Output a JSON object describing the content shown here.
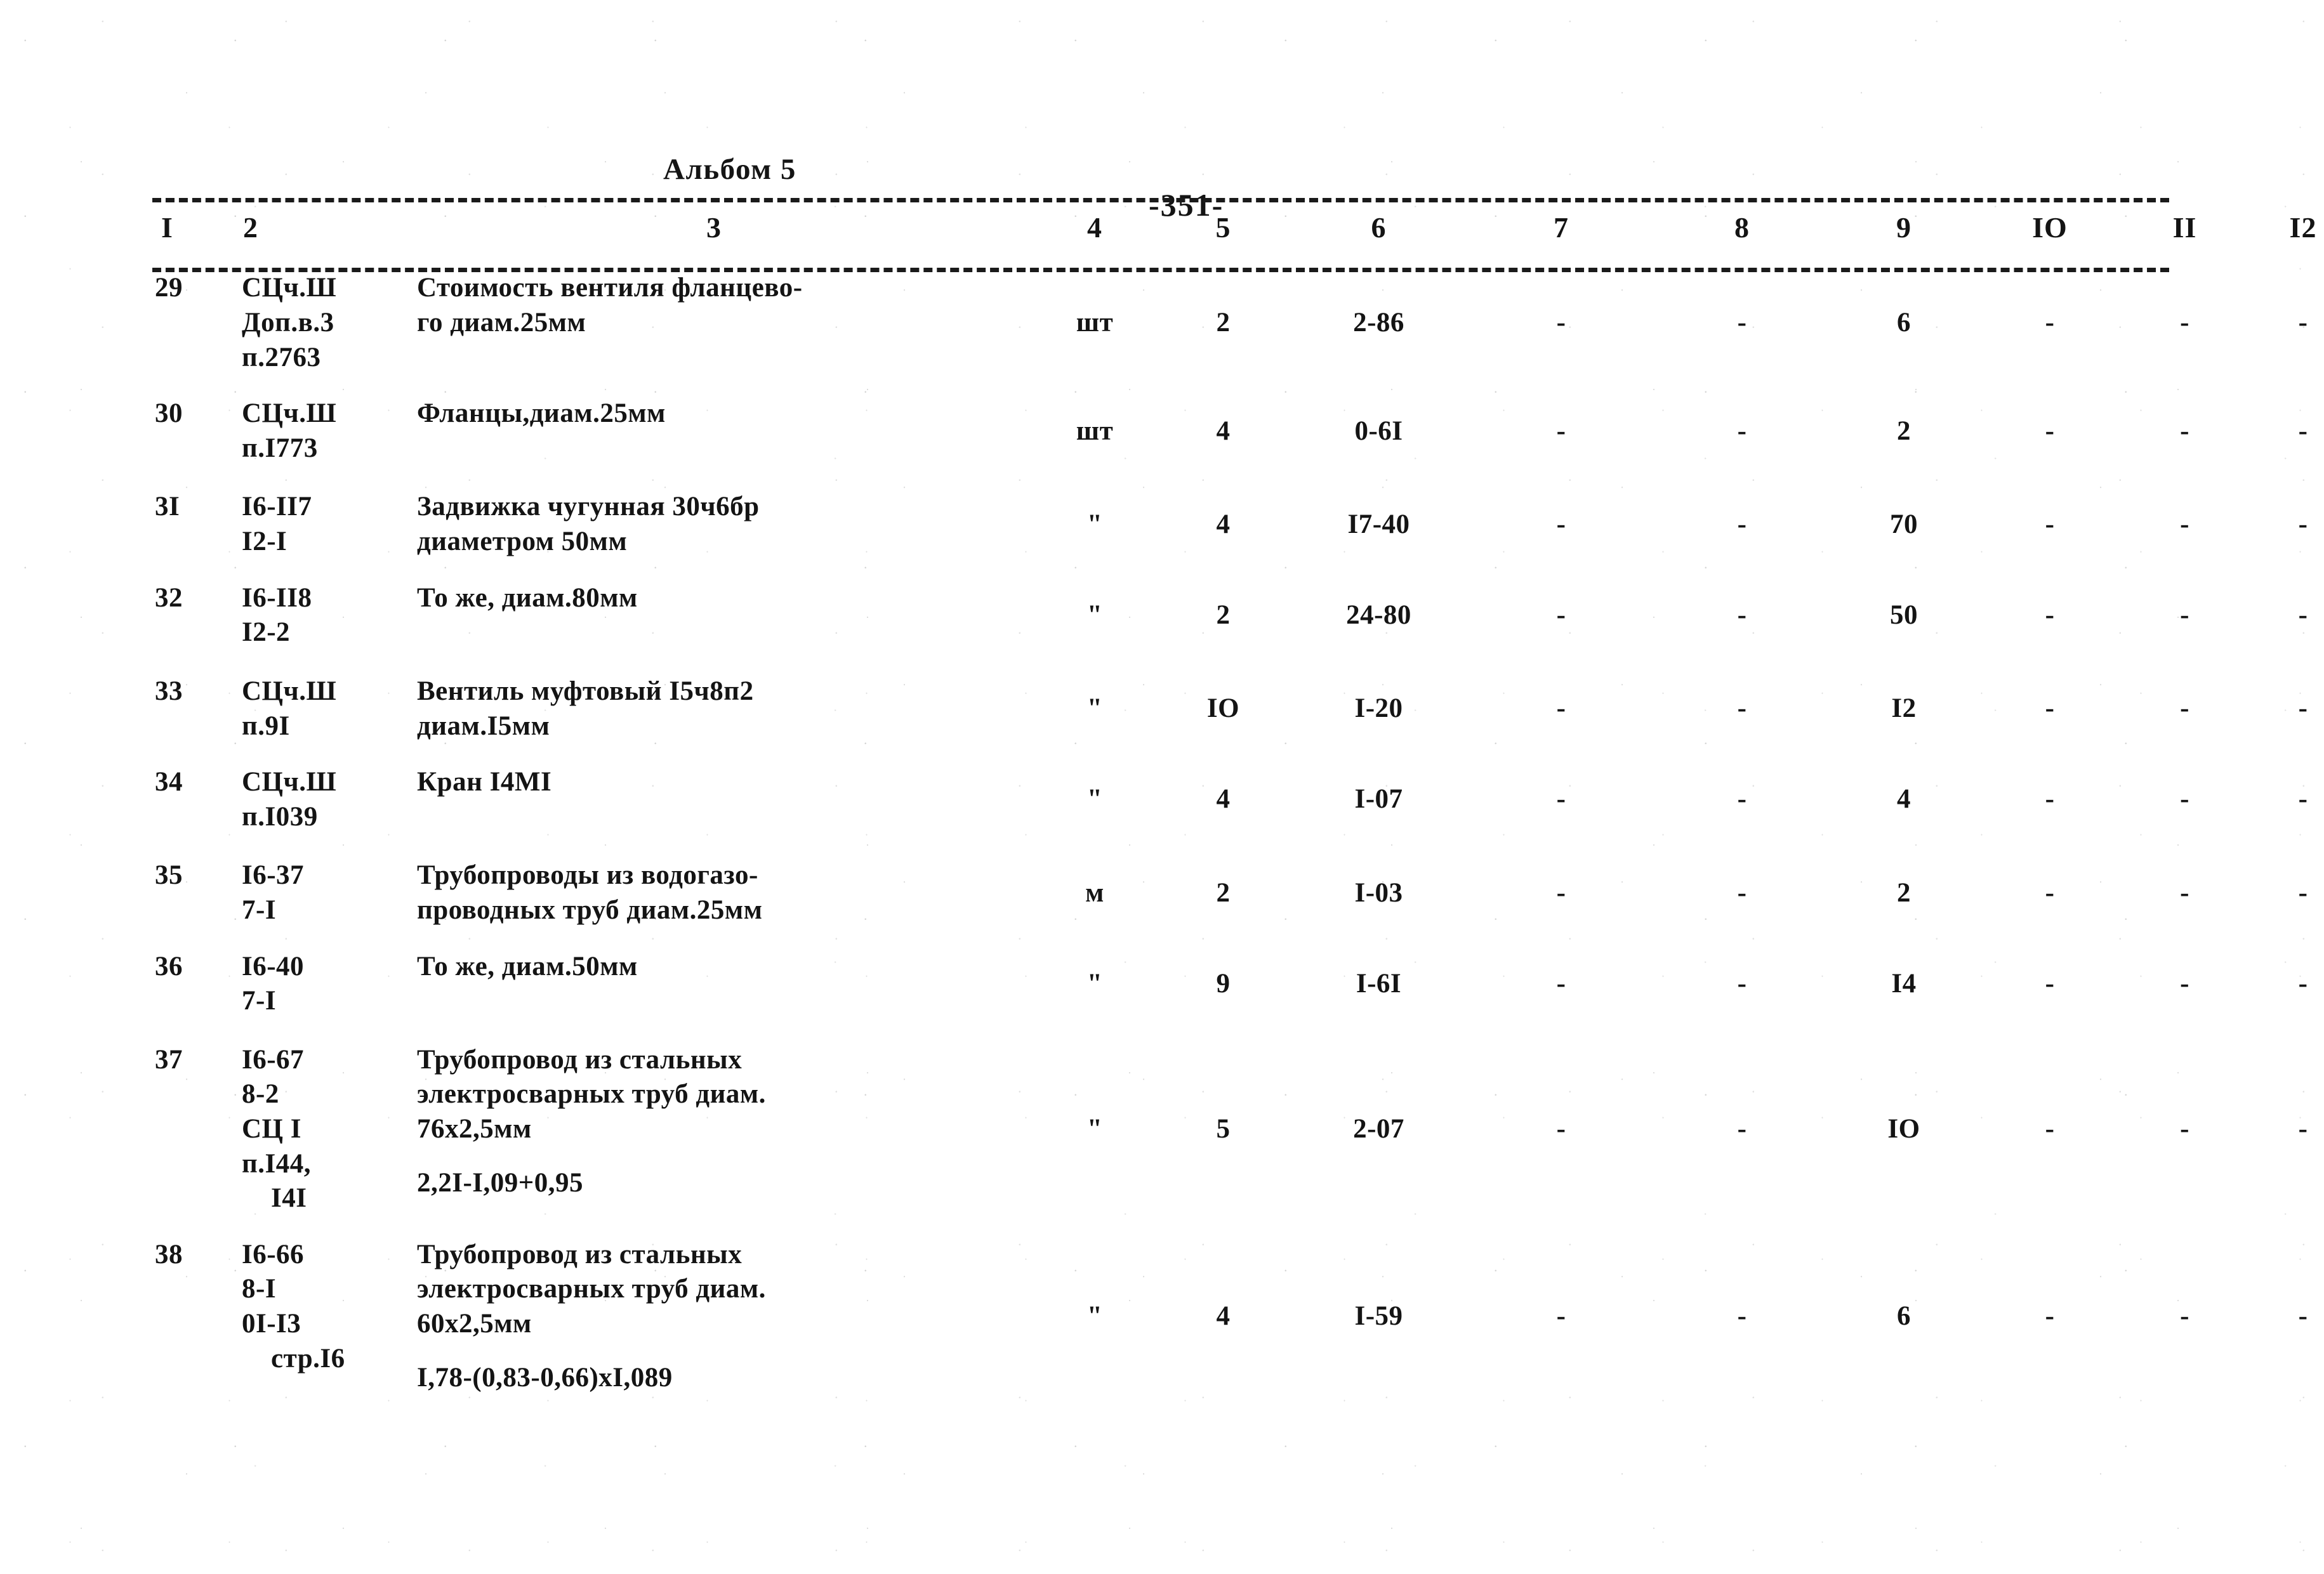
{
  "document": {
    "album_label": "Альбом 5",
    "page_number": "-351-"
  },
  "table": {
    "column_headers": [
      "I",
      "2",
      "3",
      "4",
      "5",
      "6",
      "7",
      "8",
      "9",
      "IO",
      "II",
      "I2"
    ],
    "dash_placeholder": "-",
    "rows": [
      {
        "num": "29",
        "code_lines": [
          "СЦч.Ш",
          "Доп.в.3",
          "п.2763"
        ],
        "desc_lines": [
          "Стоимость вентиля фланцево-",
          "го диам.25мм"
        ],
        "unit": "шт",
        "qty": "2",
        "price": "2-86",
        "col7": "-",
        "col8": "-",
        "col9": "6",
        "col10": "-",
        "col11": "-",
        "col12": "-"
      },
      {
        "num": "30",
        "code_lines": [
          "СЦч.Ш",
          "п.I773"
        ],
        "desc_lines": [
          "Фланцы,диам.25мм"
        ],
        "unit": "шт",
        "qty": "4",
        "price": "0-6I",
        "col7": "-",
        "col8": "-",
        "col9": "2",
        "col10": "-",
        "col11": "-",
        "col12": "-"
      },
      {
        "num": "3I",
        "code_lines": [
          "I6-II7",
          "I2-I"
        ],
        "desc_lines": [
          "Задвижка чугунная 30ч6бр",
          "диаметром 50мм"
        ],
        "unit": "\"",
        "qty": "4",
        "price": "I7-40",
        "col7": "-",
        "col8": "-",
        "col9": "70",
        "col10": "-",
        "col11": "-",
        "col12": "-"
      },
      {
        "num": "32",
        "code_lines": [
          "I6-II8",
          "I2-2"
        ],
        "desc_lines": [
          "То же, диам.80мм"
        ],
        "unit": "\"",
        "qty": "2",
        "price": "24-80",
        "col7": "-",
        "col8": "-",
        "col9": "50",
        "col10": "-",
        "col11": "-",
        "col12": "-"
      },
      {
        "num": "33",
        "code_lines": [
          "СЦч.Ш",
          "п.9I"
        ],
        "desc_lines": [
          "Вентиль муфтовый I5ч8п2",
          "диам.I5мм"
        ],
        "unit": "\"",
        "qty": "IO",
        "price": "I-20",
        "col7": "-",
        "col8": "-",
        "col9": "I2",
        "col10": "-",
        "col11": "-",
        "col12": "-"
      },
      {
        "num": "34",
        "code_lines": [
          "СЦч.Ш",
          "п.I039"
        ],
        "desc_lines": [
          "Кран I4МI"
        ],
        "unit": "\"",
        "qty": "4",
        "price": "I-07",
        "col7": "-",
        "col8": "-",
        "col9": "4",
        "col10": "-",
        "col11": "-",
        "col12": "-"
      },
      {
        "num": "35",
        "code_lines": [
          "I6-37",
          "7-I"
        ],
        "desc_lines": [
          "Трубопроводы из водогазо-",
          "проводных труб диам.25мм"
        ],
        "unit": "м",
        "qty": "2",
        "price": "I-03",
        "col7": "-",
        "col8": "-",
        "col9": "2",
        "col10": "-",
        "col11": "-",
        "col12": "-"
      },
      {
        "num": "36",
        "code_lines": [
          "I6-40",
          "7-I"
        ],
        "desc_lines": [
          "То же, диам.50мм"
        ],
        "unit": "\"",
        "qty": "9",
        "price": "I-6I",
        "col7": "-",
        "col8": "-",
        "col9": "I4",
        "col10": "-",
        "col11": "-",
        "col12": "-"
      },
      {
        "num": "37",
        "code_lines": [
          "I6-67",
          "8-2",
          "СЦ I",
          "п.I44,",
          "I4I"
        ],
        "code_indent": [
          false,
          false,
          false,
          false,
          true
        ],
        "desc_lines": [
          "Трубопровод из стальных",
          "электросварных труб диам.",
          "76х2,5мм"
        ],
        "desc_formula": "2,2I-I,09+0,95",
        "unit": "\"",
        "qty": "5",
        "price": "2-07",
        "col7": "-",
        "col8": "-",
        "col9": "IO",
        "col10": "-",
        "col11": "-",
        "col12": "-"
      },
      {
        "num": "38",
        "code_lines": [
          "I6-66",
          "8-I",
          "0I-I3",
          "стр.I6"
        ],
        "code_indent": [
          false,
          false,
          false,
          true
        ],
        "desc_lines": [
          "Трубопровод из стальных",
          "электросварных труб диам.",
          "60х2,5мм"
        ],
        "desc_formula": "I,78-(0,83-0,66)хI,089",
        "unit": "\"",
        "qty": "4",
        "price": "I-59",
        "col7": "-",
        "col8": "-",
        "col9": "6",
        "col10": "-",
        "col11": "-",
        "col12": "-"
      }
    ]
  }
}
